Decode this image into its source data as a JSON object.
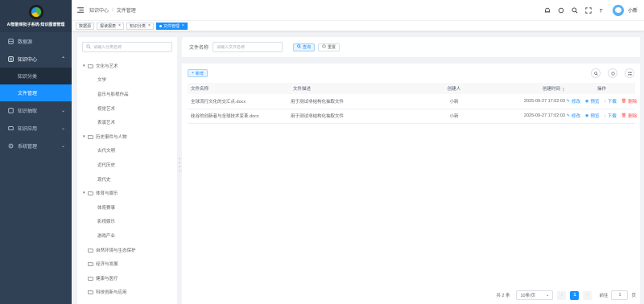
{
  "app": {
    "title": "AI智能审批子系统-知识图谱管理"
  },
  "sidebar": {
    "items": [
      {
        "label": "数据源",
        "icon": "database-icon"
      },
      {
        "label": "知识中心",
        "icon": "knowledge-icon",
        "expanded": true,
        "children": [
          {
            "label": "知识分类"
          },
          {
            "label": "文件管理",
            "active": true
          }
        ]
      },
      {
        "label": "知识抽取",
        "icon": "extract-icon"
      },
      {
        "label": "知识应用",
        "icon": "apply-icon"
      },
      {
        "label": "系统管理",
        "icon": "gear-icon"
      }
    ],
    "accent": "#1890ff",
    "background": "#304156"
  },
  "header": {
    "breadcrumb": [
      "知识中心",
      "文件管理"
    ],
    "username": "小新"
  },
  "tags": [
    {
      "label": "数据源",
      "closable": false
    },
    {
      "label": "报读报表",
      "closable": true
    },
    {
      "label": "知识分类",
      "closable": true
    },
    {
      "label": "文件管理",
      "closable": true,
      "active": true
    }
  ],
  "tree": {
    "search_placeholder": "请输入分类名称",
    "nodes": [
      {
        "label": "文化与艺术",
        "expanded": true,
        "children": [
          "文学",
          "音乐与影视作品",
          "视觉艺术",
          "表演艺术"
        ]
      },
      {
        "label": "历史事件与人物",
        "expanded": true,
        "children": [
          "古代文明",
          "近代历史",
          "现代史"
        ]
      },
      {
        "label": "体育与娱乐",
        "expanded": true,
        "children": [
          "体育赛事",
          "影视娱乐",
          "游戏产业"
        ]
      },
      {
        "label": "自然环境与生态保护",
        "expanded": false,
        "children": []
      },
      {
        "label": "经济与发展",
        "expanded": false,
        "children": []
      },
      {
        "label": "健康与医疗",
        "expanded": false,
        "children": []
      },
      {
        "label": "科技创新与应用",
        "expanded": false,
        "children": []
      }
    ]
  },
  "search": {
    "file_name_label": "文件名称",
    "file_name_placeholder": "请输入文件名称",
    "search_button": "查询",
    "reset_button": "重置"
  },
  "toolbar": {
    "add_button": "新增"
  },
  "table": {
    "columns": [
      "文件名称",
      "文件描述",
      "创建人",
      "创建时间",
      "操作"
    ],
    "rows": [
      {
        "name": "全球流行文化的交汇点.docx",
        "desc": "用于测试非结构化抽取文件",
        "creator": "小新",
        "created": "2025-09-27 17:02:03"
      },
      {
        "name": "硅谷的创新者与全球技术变革.docx",
        "desc": "用于测试非结构化抽取文件",
        "creator": "小新",
        "created": "2025-09-27 17:02:03"
      }
    ],
    "actions": {
      "edit": "修改",
      "preview": "预览",
      "download": "下载",
      "delete": "删除"
    }
  },
  "pagination": {
    "total_text": "共 2 条",
    "page_size": "10条/页",
    "current_page": "1",
    "goto_label": "前往",
    "goto_value": "1",
    "page_suffix": "页"
  }
}
